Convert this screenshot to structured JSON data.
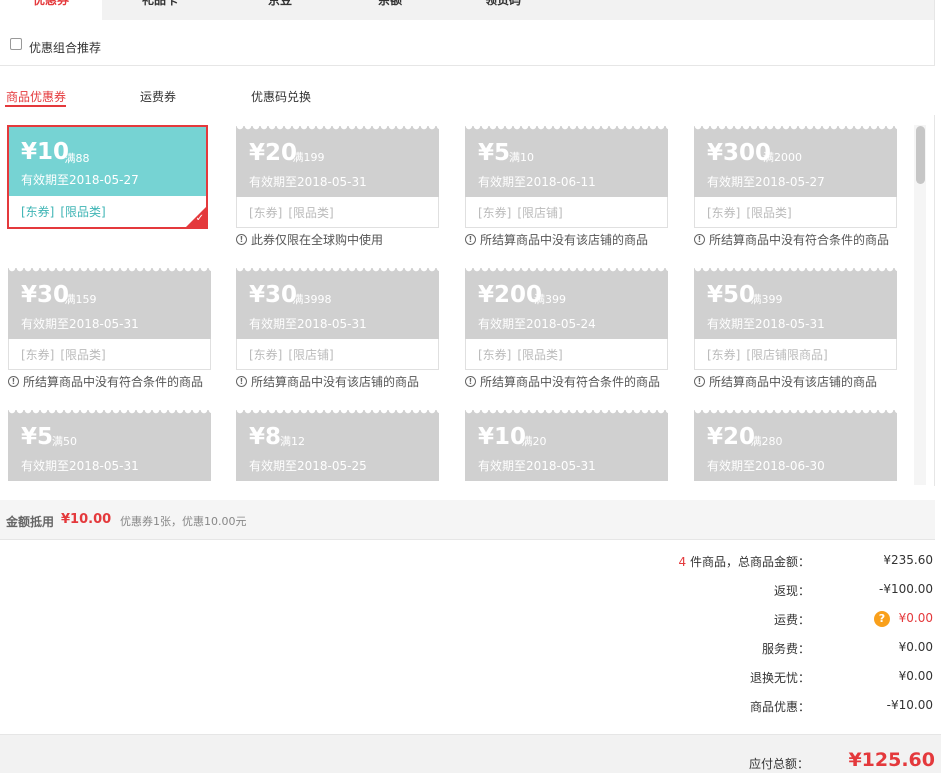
{
  "top_tabs": [
    {
      "label": "优惠券",
      "active": true
    },
    {
      "label": "礼品卡",
      "active": false
    },
    {
      "label": "京豆",
      "active": false
    },
    {
      "label": "余额",
      "active": false
    },
    {
      "label": "领货码",
      "active": false
    }
  ],
  "combo": {
    "label": "优惠组合推荐",
    "checked": false
  },
  "sub_tabs": [
    {
      "label": "商品优惠券",
      "active": true
    },
    {
      "label": "运费券",
      "active": false
    },
    {
      "label": "优惠码兑换",
      "active": false
    }
  ],
  "coupons": [
    {
      "amount": "¥10",
      "condition": "满88",
      "valid": "有效期至2018-05-27",
      "tags": [
        "[东券]",
        "[限品类]"
      ],
      "note": "",
      "active": true
    },
    {
      "amount": "¥20",
      "condition": "满199",
      "valid": "有效期至2018-05-31",
      "tags": [
        "[东券]",
        "[限品类]"
      ],
      "note": "此券仅限在全球购中使用",
      "active": false
    },
    {
      "amount": "¥5",
      "condition": "满10",
      "valid": "有效期至2018-06-11",
      "tags": [
        "[东券]",
        "[限店铺]"
      ],
      "note": "所结算商品中没有该店铺的商品",
      "active": false
    },
    {
      "amount": "¥300",
      "condition": "满2000",
      "valid": "有效期至2018-05-27",
      "tags": [
        "[东券]",
        "[限品类]"
      ],
      "note": "所结算商品中没有符合条件的商品",
      "active": false
    },
    {
      "amount": "¥30",
      "condition": "满159",
      "valid": "有效期至2018-05-31",
      "tags": [
        "[东券]",
        "[限品类]"
      ],
      "note": "所结算商品中没有符合条件的商品",
      "active": false
    },
    {
      "amount": "¥30",
      "condition": "满3998",
      "valid": "有效期至2018-05-31",
      "tags": [
        "[东券]",
        "[限店铺]"
      ],
      "note": "所结算商品中没有该店铺的商品",
      "active": false
    },
    {
      "amount": "¥200",
      "condition": "满399",
      "valid": "有效期至2018-05-24",
      "tags": [
        "[东券]",
        "[限品类]"
      ],
      "note": "所结算商品中没有符合条件的商品",
      "active": false
    },
    {
      "amount": "¥50",
      "condition": "满399",
      "valid": "有效期至2018-05-31",
      "tags": [
        "[东券]",
        "[限店铺限商品]"
      ],
      "note": "所结算商品中没有该店铺的商品",
      "active": false
    },
    {
      "amount": "¥5",
      "condition": "满50",
      "valid": "有效期至2018-05-31",
      "tags": [],
      "note": "",
      "active": false
    },
    {
      "amount": "¥8",
      "condition": "满12",
      "valid": "有效期至2018-05-25",
      "tags": [],
      "note": "",
      "active": false
    },
    {
      "amount": "¥10",
      "condition": "满20",
      "valid": "有效期至2018-05-31",
      "tags": [],
      "note": "",
      "active": false
    },
    {
      "amount": "¥20",
      "condition": "满280",
      "valid": "有效期至2018-06-30",
      "tags": [],
      "note": "",
      "active": false
    }
  ],
  "deduction": {
    "label": "金额抵用",
    "amount": "¥10.00",
    "desc": "优惠券1张，优惠10.00元"
  },
  "summary": {
    "count": "4",
    "count_suffix": "件商品，总商品金额：",
    "total_goods": "¥235.60",
    "rows": [
      {
        "label": "返现：",
        "value": "-¥100.00"
      },
      {
        "label": "运费：",
        "value": "¥0.00",
        "icon": "question-icon"
      },
      {
        "label": "服务费：",
        "value": "¥0.00"
      },
      {
        "label": "退换无忧：",
        "value": "¥0.00"
      },
      {
        "label": "商品优惠：",
        "value": "-¥10.00"
      }
    ]
  },
  "total": {
    "label": "应付总额：",
    "amount": "¥125.60"
  },
  "colors": {
    "accent": "#e4393c",
    "active_coupon": "#76d3d3",
    "disabled_coupon": "#d0d0d0",
    "question_icon": "#f9a01b"
  }
}
